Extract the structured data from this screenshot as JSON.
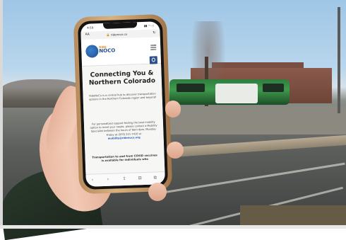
{
  "phone_screen": {
    "status_time": "4:59",
    "status_signal": "▮▮ ◠ ▭",
    "url_bar": {
      "aa_label": "AA",
      "url": "🔒 ridenoco.co",
      "reload_icon": "reload-icon"
    },
    "header": {
      "logo_icon": "logo-globe-icon",
      "logo_ride": "RIDE",
      "logo_noco": "NOCO",
      "menu_icon": "hamburger-menu-icon",
      "accessibility_icon": "accessibility-icon"
    },
    "hero": {
      "title": "Connecting You & Northern Colorado",
      "paragraph_1": "RideNoCo is a central hub to discover transportation options in the Northern Colorado region and beyond!",
      "paragraph_2_prefix": "For personalized support finding the best mobility option to meet your needs, please contact a Mobility Specialist between the hours of 9am-4pm, Monday-Friday at (970) 221-7410 or",
      "paragraph_2_link": "mobility@ridenoco.org",
      "paragraph_3": "Transportation to and from COVID vaccines is available for individuals who"
    },
    "toolbar_icons": [
      "back-icon",
      "forward-icon",
      "share-icon",
      "bookmarks-icon",
      "tabs-icon"
    ],
    "toolbar_glyphs": [
      "‹",
      "›",
      "⇪",
      "⊟",
      "⧉"
    ]
  }
}
